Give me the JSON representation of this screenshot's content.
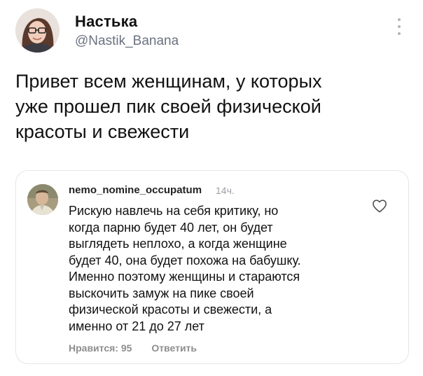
{
  "tweet": {
    "author_name": "Настька",
    "author_handle": "@Nastik_Banana",
    "text": "Привет всем женщинам, у которых\nуже прошел пик своей физической\nкрасоты и свежести"
  },
  "quoted_comment": {
    "author": "nemo_nomine_occupatum",
    "time": "14ч.",
    "text": "Рискую навлечь на себя критику, но\nкогда парню будет 40 лет, он будет\nвыглядеть неплохо, а когда женщине\nбудет 40, она будет похожа на бабушку.\nИменно поэтому женщины и стараются\nвыскочить замуж на пике своей\nфизической красоты и свежести, а\nименно от 21 до 27 лет",
    "likes_label": "Нравится: 95",
    "reply_label": "Ответить"
  },
  "icons": {
    "more": "more-vertical-icon",
    "heart": "heart-outline-icon"
  },
  "colors": {
    "secondary_text": "#6b7280",
    "card_border": "#e4e6ea"
  }
}
